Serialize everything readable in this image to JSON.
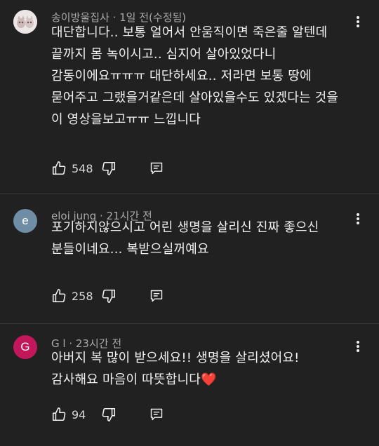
{
  "comments": [
    {
      "author": "송이방울집사",
      "time": "1일 전(수정됨)",
      "avatar_letter": "",
      "text": "대단합니다.. 보통 얼어서 안움직이면 죽은줄 알텐데\n끝까지 몸 녹이시고.. 심지어 살아있었다니\n감동이에요ㅠㅠㅠ 대단하세요.. 저라면 보통 땅에\n묻어주고 그랬을거같은데  살아있을수도 있겠다는 것을\n이 영상을보고ㅠㅠ 느낍니다",
      "likes": "548"
    },
    {
      "author": "eloi jung",
      "time": "21시간 전",
      "avatar_letter": "e",
      "text": "포기하지않으시고 어린 생명을 살리신  진짜  좋으신\n분들이네요...  복받으실꺼예요",
      "likes": "258"
    },
    {
      "author": "G l",
      "time": "23시간 전",
      "avatar_letter": "G",
      "text": "아버지  복 많이 받으세요!!   생명을 살리셨어요!\n감사해요 마음이 따뜻합니다",
      "emoji": "❤️",
      "likes": "94"
    }
  ],
  "colors": {
    "background": "#212121",
    "text": "#f1f1f1",
    "meta": "#aaaaaa",
    "avatar_e": "#6f8ea5",
    "avatar_g": "#c2185b",
    "heart": "#e53935"
  },
  "icons": [
    "thumbs-up-icon",
    "thumbs-down-icon",
    "reply-icon",
    "more-vertical-icon"
  ]
}
